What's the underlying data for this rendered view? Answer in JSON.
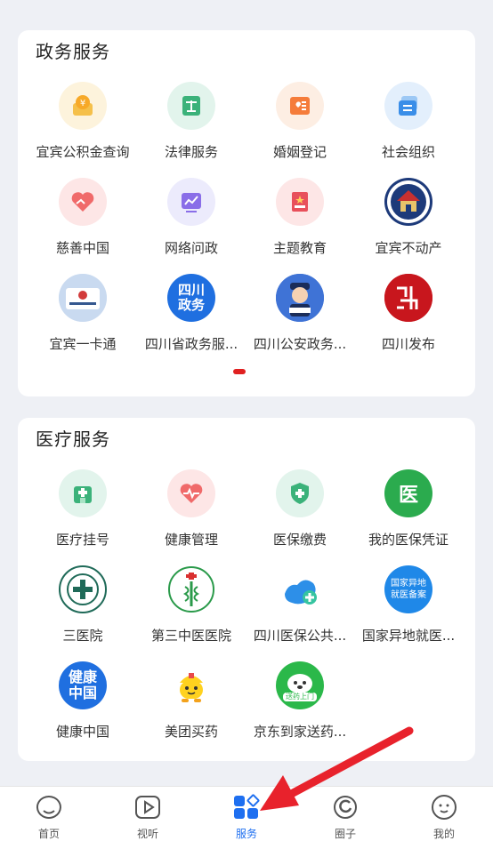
{
  "gov_section": {
    "title": "政务服务",
    "items": [
      {
        "label": "宜宾公积金查询",
        "icon": "gold-coin-icon"
      },
      {
        "label": "法律服务",
        "icon": "law-book-icon"
      },
      {
        "label": "婚姻登记",
        "icon": "marriage-book-icon"
      },
      {
        "label": "社会组织",
        "icon": "organization-card-icon"
      },
      {
        "label": "慈善中国",
        "icon": "charity-heart-icon"
      },
      {
        "label": "网络问政",
        "icon": "chart-screen-icon"
      },
      {
        "label": "主题教育",
        "icon": "red-book-icon"
      },
      {
        "label": "宜宾不动产",
        "icon": "real-estate-emblem-icon"
      },
      {
        "label": "宜宾一卡通",
        "icon": "social-security-card-icon"
      },
      {
        "label": "四川省政务服...",
        "icon": "sichuan-gov-icon",
        "icon_text": "四川政务"
      },
      {
        "label": "四川公安政务...",
        "icon": "police-avatar-icon"
      },
      {
        "label": "四川发布",
        "icon": "sichuan-release-icon"
      }
    ]
  },
  "medical_section": {
    "title": "医疗服务",
    "items": [
      {
        "label": "医疗挂号",
        "icon": "hospital-icon"
      },
      {
        "label": "健康管理",
        "icon": "heart-pulse-icon"
      },
      {
        "label": "医保缴费",
        "icon": "shield-plus-icon"
      },
      {
        "label": "我的医保凭证",
        "icon": "medical-insurance-icon",
        "icon_text": "医"
      },
      {
        "label": "三医院",
        "icon": "third-hospital-emblem-icon"
      },
      {
        "label": "第三中医医院",
        "icon": "tcm-hospital-emblem-icon"
      },
      {
        "label": "四川医保公共...",
        "icon": "sichuan-insurance-icon"
      },
      {
        "label": "国家异地就医...",
        "icon": "remote-medical-icon",
        "icon_text": "国家异地就医备案"
      },
      {
        "label": "健康中国",
        "icon": "healthy-china-icon",
        "icon_text": "健康中国"
      },
      {
        "label": "美团买药",
        "icon": "meituan-medicine-icon"
      },
      {
        "label": "京东到家送药...",
        "icon": "jd-delivery-icon",
        "icon_text": "送药上门"
      }
    ]
  },
  "tabbar": {
    "tabs": [
      {
        "label": "首页",
        "icon": "home-face-icon"
      },
      {
        "label": "视听",
        "icon": "play-icon"
      },
      {
        "label": "服务",
        "icon": "service-grid-icon",
        "active": true
      },
      {
        "label": "圈子",
        "icon": "circle-icon"
      },
      {
        "label": "我的",
        "icon": "profile-face-icon"
      }
    ]
  },
  "colors": {
    "accent": "#1e6ff0",
    "annotation_arrow": "#e8222c",
    "page_dot": "#e02020"
  }
}
